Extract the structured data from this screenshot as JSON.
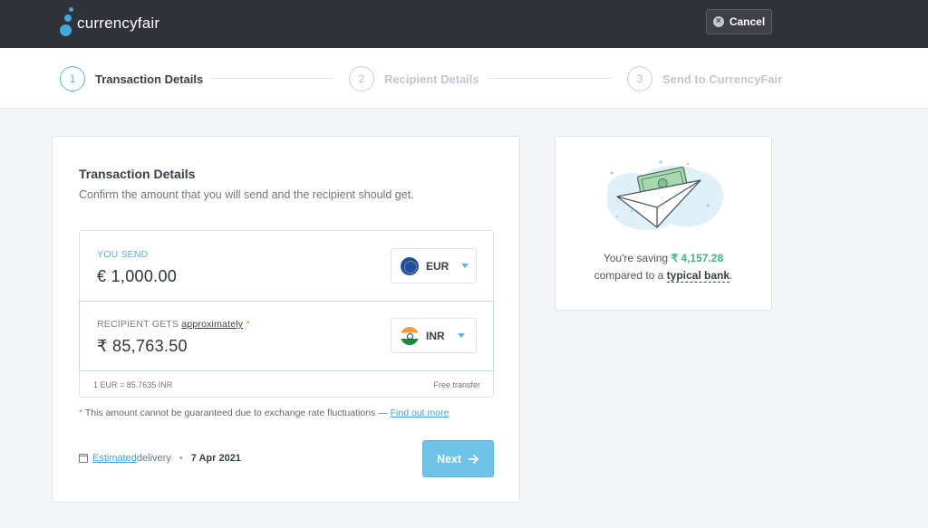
{
  "header": {
    "brand": "currencyfair",
    "cancel_label": "Cancel"
  },
  "stepper": {
    "steps": [
      {
        "num": "1",
        "label": "Transaction Details",
        "active": true
      },
      {
        "num": "2",
        "label": "Recipient Details",
        "active": false
      },
      {
        "num": "3",
        "label": "Send to CurrencyFair",
        "active": false
      }
    ]
  },
  "transaction": {
    "title": "Transaction Details",
    "subtitle": "Confirm the amount that you will send and the recipient should get.",
    "send": {
      "label": "YOU SEND",
      "value": "€ 1,000.00",
      "currency": "EUR"
    },
    "receive": {
      "label_prefix": "RECIPIENT GETS ",
      "label_link": "approximately",
      "star": "*",
      "value": "₹ 85,763.50",
      "currency": "INR"
    },
    "rate": "1 EUR = 85.7635 INR",
    "fee": "Free transfer",
    "disclaimer": {
      "star": "*",
      "text": " This amount cannot be guaranteed due to exchange rate fluctuations — ",
      "link": "Find out more"
    },
    "delivery": {
      "link": "Estimated",
      "text": " delivery",
      "separator": "•",
      "date": "7 Apr 2021"
    },
    "next_label": "Next"
  },
  "savings": {
    "prefix": "You're saving ",
    "amount": "₹ 4,157.28",
    "compare_prefix": "compared to a ",
    "compare_link": "typical bank",
    "compare_suffix": "."
  },
  "colors": {
    "accent": "#5ab4e3",
    "header_bg": "#303139",
    "savings_green": "#45b57c",
    "warning_orange": "#e8893a"
  }
}
